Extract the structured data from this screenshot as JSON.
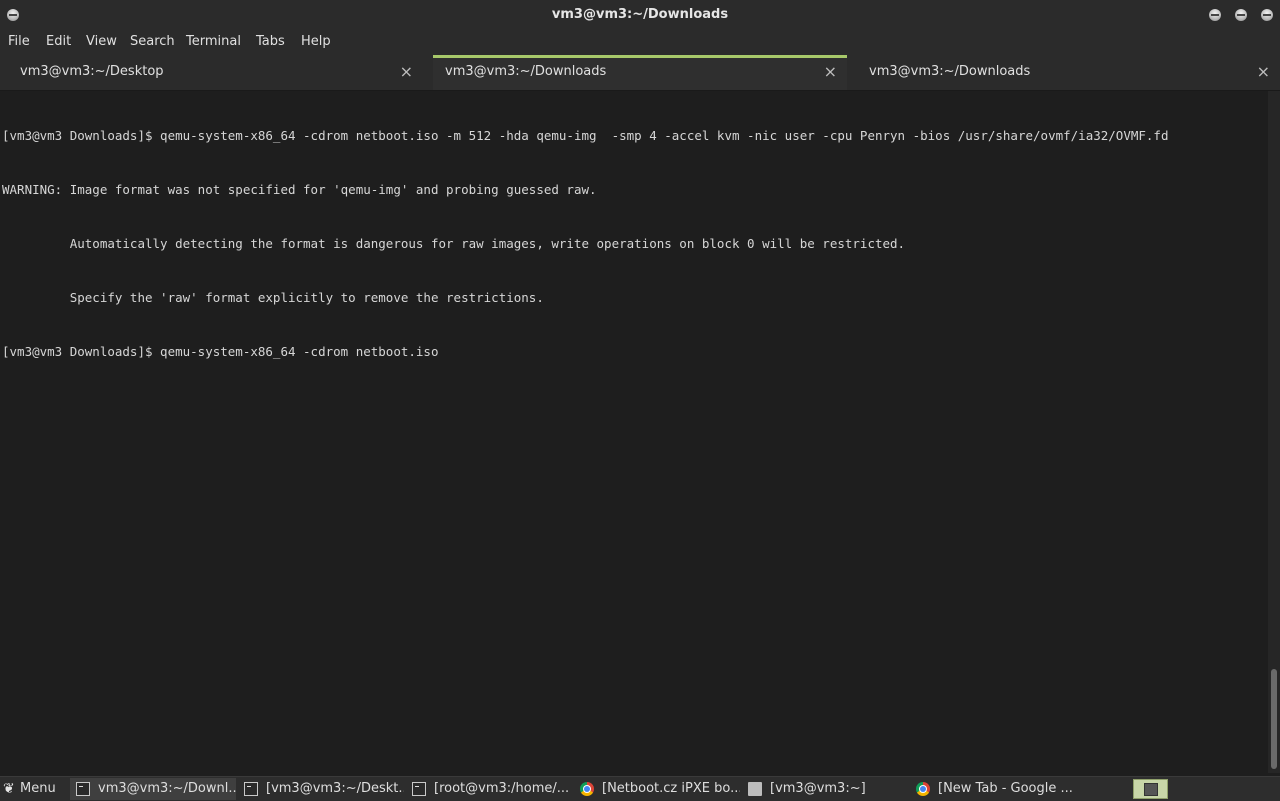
{
  "window": {
    "title": "vm3@vm3:~/Downloads"
  },
  "menu": [
    "File",
    "Edit",
    "View",
    "Search",
    "Terminal",
    "Tabs",
    "Help"
  ],
  "tabs": [
    {
      "label": "vm3@vm3:~/Desktop",
      "active": false
    },
    {
      "label": "vm3@vm3:~/Downloads",
      "active": true
    },
    {
      "label": "vm3@vm3:~/Downloads",
      "active": false
    }
  ],
  "tab_close": "×",
  "terminal": {
    "lines": [
      "[vm3@vm3 Downloads]$ qemu-system-x86_64 -cdrom netboot.iso -m 512 -hda qemu-img  -smp 4 -accel kvm -nic user -cpu Penryn -bios /usr/share/ovmf/ia32/OVMF.fd",
      "WARNING: Image format was not specified for 'qemu-img' and probing guessed raw.",
      "         Automatically detecting the format is dangerous for raw images, write operations on block 0 will be restricted.",
      "         Specify the 'raw' format explicitly to remove the restrictions.",
      "[vm3@vm3 Downloads]$ qemu-system-x86_64 -cdrom netboot.iso "
    ]
  },
  "taskbar": {
    "menu_label": "Menu",
    "menu_icon": "gnome-foot-icon",
    "tasks": [
      {
        "label": "vm3@vm3:~/Downl...",
        "icon": "terminal-icon",
        "active": true
      },
      {
        "label": "[vm3@vm3:~/Deskt...",
        "icon": "terminal-icon",
        "active": false
      },
      {
        "label": "[root@vm3:/home/...",
        "icon": "terminal-icon",
        "active": false
      },
      {
        "label": "[Netboot.cz iPXE bo...",
        "icon": "chrome-icon",
        "active": false
      },
      {
        "label": "[vm3@vm3:~]",
        "icon": "folder-icon",
        "active": false
      },
      {
        "label": "[New Tab - Google ...",
        "icon": "chrome-icon",
        "active": false
      }
    ]
  }
}
